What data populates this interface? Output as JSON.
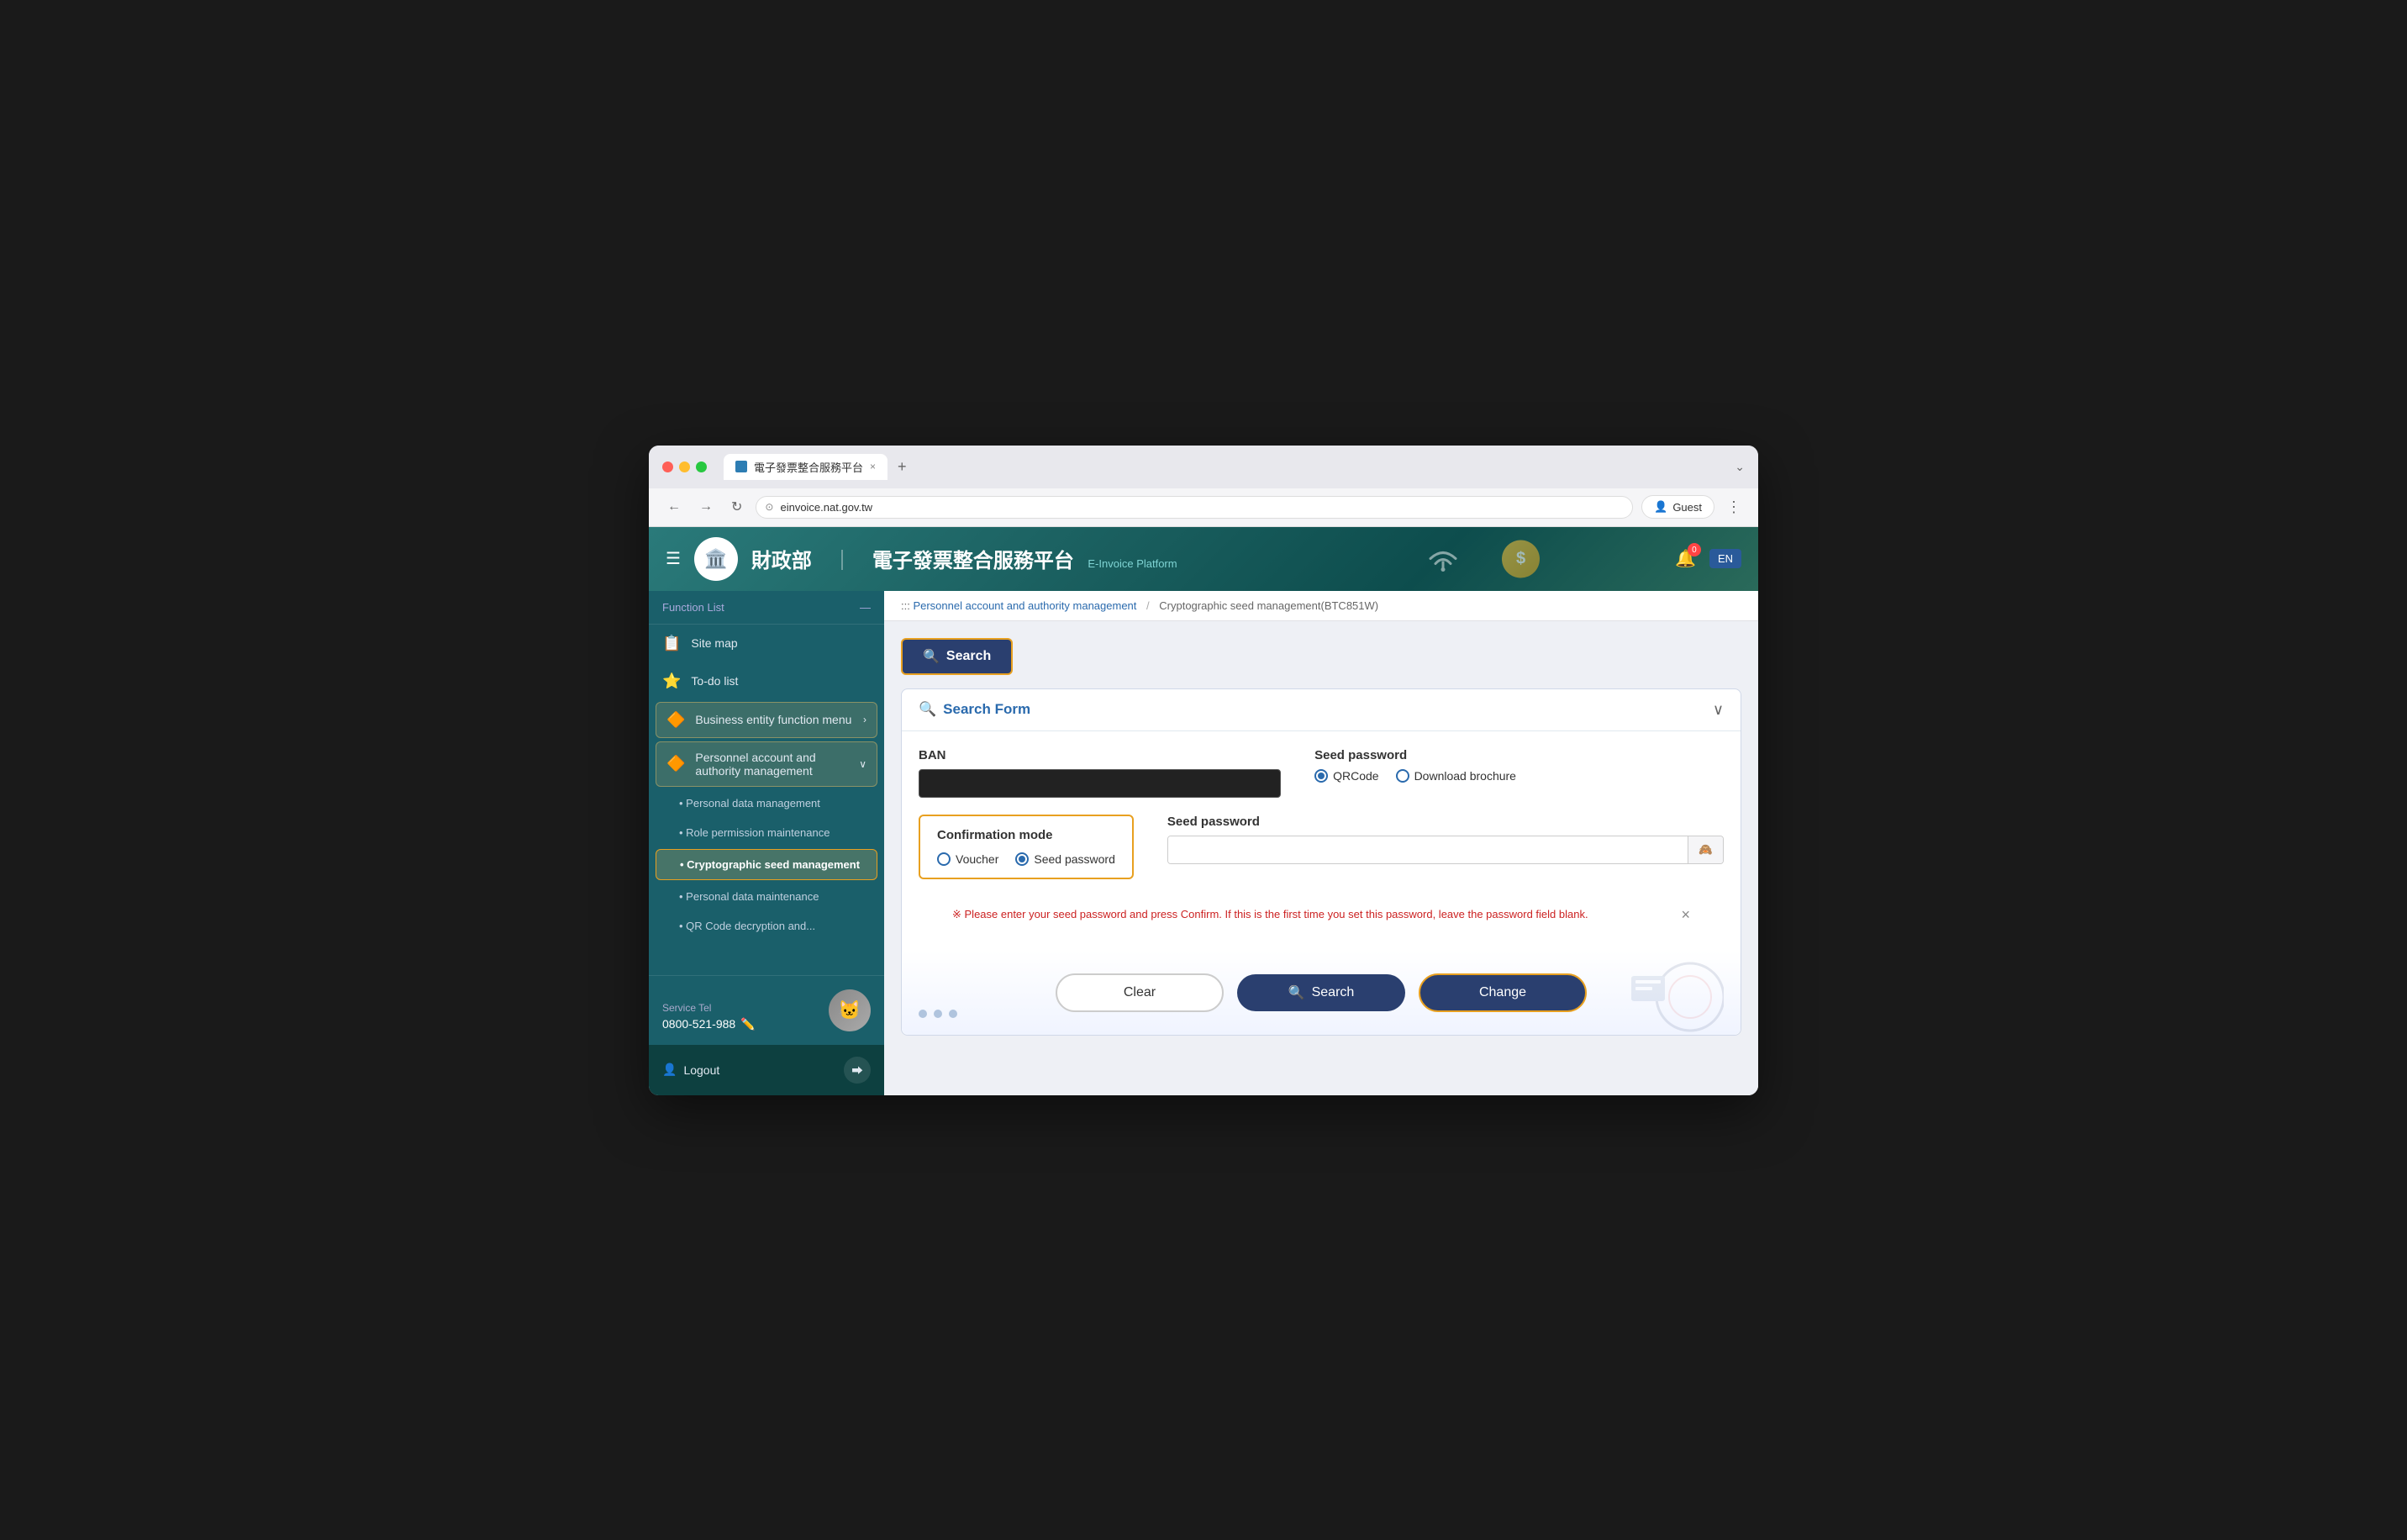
{
  "browser": {
    "tab_title": "電子發票整合服務平台",
    "tab_close": "×",
    "tab_new": "+",
    "address": "einvoice.nat.gov.tw",
    "guest_label": "Guest",
    "tab_menu": "⌄"
  },
  "header": {
    "logo_emoji": "🏛️",
    "title": "財政部",
    "separator": "｜",
    "subtitle": "電子發票整合服務平台",
    "platform_label": "E-Invoice Platform",
    "notification_count": "0",
    "lang_btn": "EN"
  },
  "sidebar": {
    "function_list_label": "Function List",
    "function_list_collapse": "—",
    "items": [
      {
        "id": "site-map",
        "icon": "📋",
        "label": "Site map"
      },
      {
        "id": "todo-list",
        "icon": "⭐",
        "label": "To-do list"
      },
      {
        "id": "business-entity",
        "icon": "🔶",
        "label": "Business entity function menu",
        "has_chevron": true
      },
      {
        "id": "personnel",
        "icon": "🔶",
        "label": "Personnel account and authority management",
        "has_chevron": true,
        "active": true
      }
    ],
    "sub_items": [
      {
        "id": "personal-data",
        "label": "Personal data management"
      },
      {
        "id": "role-permission",
        "label": "Role permission maintenance"
      },
      {
        "id": "cryptographic-seed",
        "label": "Cryptographic seed management",
        "active": true
      },
      {
        "id": "personal-data-2",
        "label": "Personal data maintenance"
      },
      {
        "id": "qr-code",
        "label": "QR Code decryption and..."
      }
    ],
    "service_tel_label": "Service Tel",
    "service_tel_number": "0800-521-988",
    "logout_label": "Logout"
  },
  "breadcrumb": {
    "sep": ":::",
    "items": [
      {
        "label": "Personnel account and authority management",
        "link": true
      },
      {
        "sep": "/",
        "label": "Cryptographic seed management(BTC851W)"
      }
    ]
  },
  "search_tab": {
    "icon": "🔍",
    "label": "Search"
  },
  "search_form": {
    "title": "Search Form",
    "title_icon": "🔍",
    "collapse_icon": "∨",
    "ban_label": "BAN",
    "ban_placeholder": "",
    "seed_password_label": "Seed password",
    "seed_password_options": [
      {
        "value": "qrcode",
        "label": "QRCode",
        "checked": true
      },
      {
        "value": "download-brochure",
        "label": "Download brochure",
        "checked": false
      }
    ],
    "confirmation_mode_label": "Confirmation mode",
    "confirmation_options": [
      {
        "value": "voucher",
        "label": "Voucher",
        "checked": false
      },
      {
        "value": "seed-password",
        "label": "Seed password",
        "checked": true
      }
    ],
    "seed_password_field_label": "Seed password",
    "seed_password_placeholder": "",
    "notice_text": "※ Please enter your seed password and press Confirm. If this is the first time you set this password, leave the password field blank.",
    "notice_close": "×"
  },
  "actions": {
    "clear_label": "Clear",
    "search_icon": "🔍",
    "search_label": "Search",
    "change_label": "Change"
  }
}
